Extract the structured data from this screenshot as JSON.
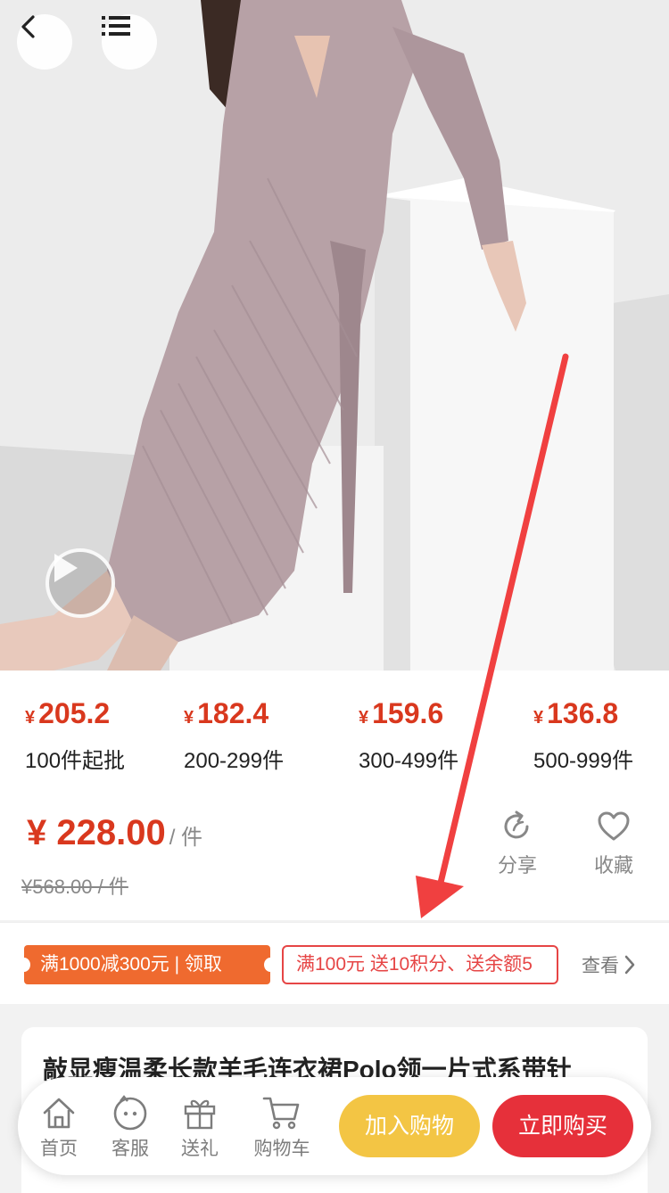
{
  "price_tiers": [
    {
      "currency": "¥",
      "price": "205.2",
      "qty": "100件起批"
    },
    {
      "currency": "¥",
      "price": "182.4",
      "qty": "200-299件"
    },
    {
      "currency": "¥",
      "price": "159.6",
      "qty": "300-499件"
    },
    {
      "currency": "¥",
      "price": "136.8",
      "qty": "500-999件"
    }
  ],
  "current_price": "¥ 228.00",
  "price_unit": "/ 件",
  "original_price": "¥568.00 / 件",
  "actions": {
    "share": "分享",
    "favorite": "收藏"
  },
  "promotions": {
    "coupon": "满1000减300元 | 领取",
    "gift": "满100元 送10积分、送余额5",
    "view_more": "查看"
  },
  "product_title": "敲显瘦温柔长款羊毛连衣裙Polo领一片式系带针",
  "bottom_nav": [
    {
      "label": "首页",
      "icon": "home-icon"
    },
    {
      "label": "客服",
      "icon": "customer-service-icon"
    },
    {
      "label": "送礼",
      "icon": "gift-icon"
    },
    {
      "label": "购物车",
      "icon": "cart-icon"
    }
  ],
  "buttons": {
    "add_to_cart": "加入购物",
    "buy_now": "立即购买"
  },
  "colors": {
    "price_red": "#d9381e",
    "coupon_orange": "#ef6a2f",
    "cart_yellow": "#f3c544",
    "buy_red": "#e6303a"
  }
}
